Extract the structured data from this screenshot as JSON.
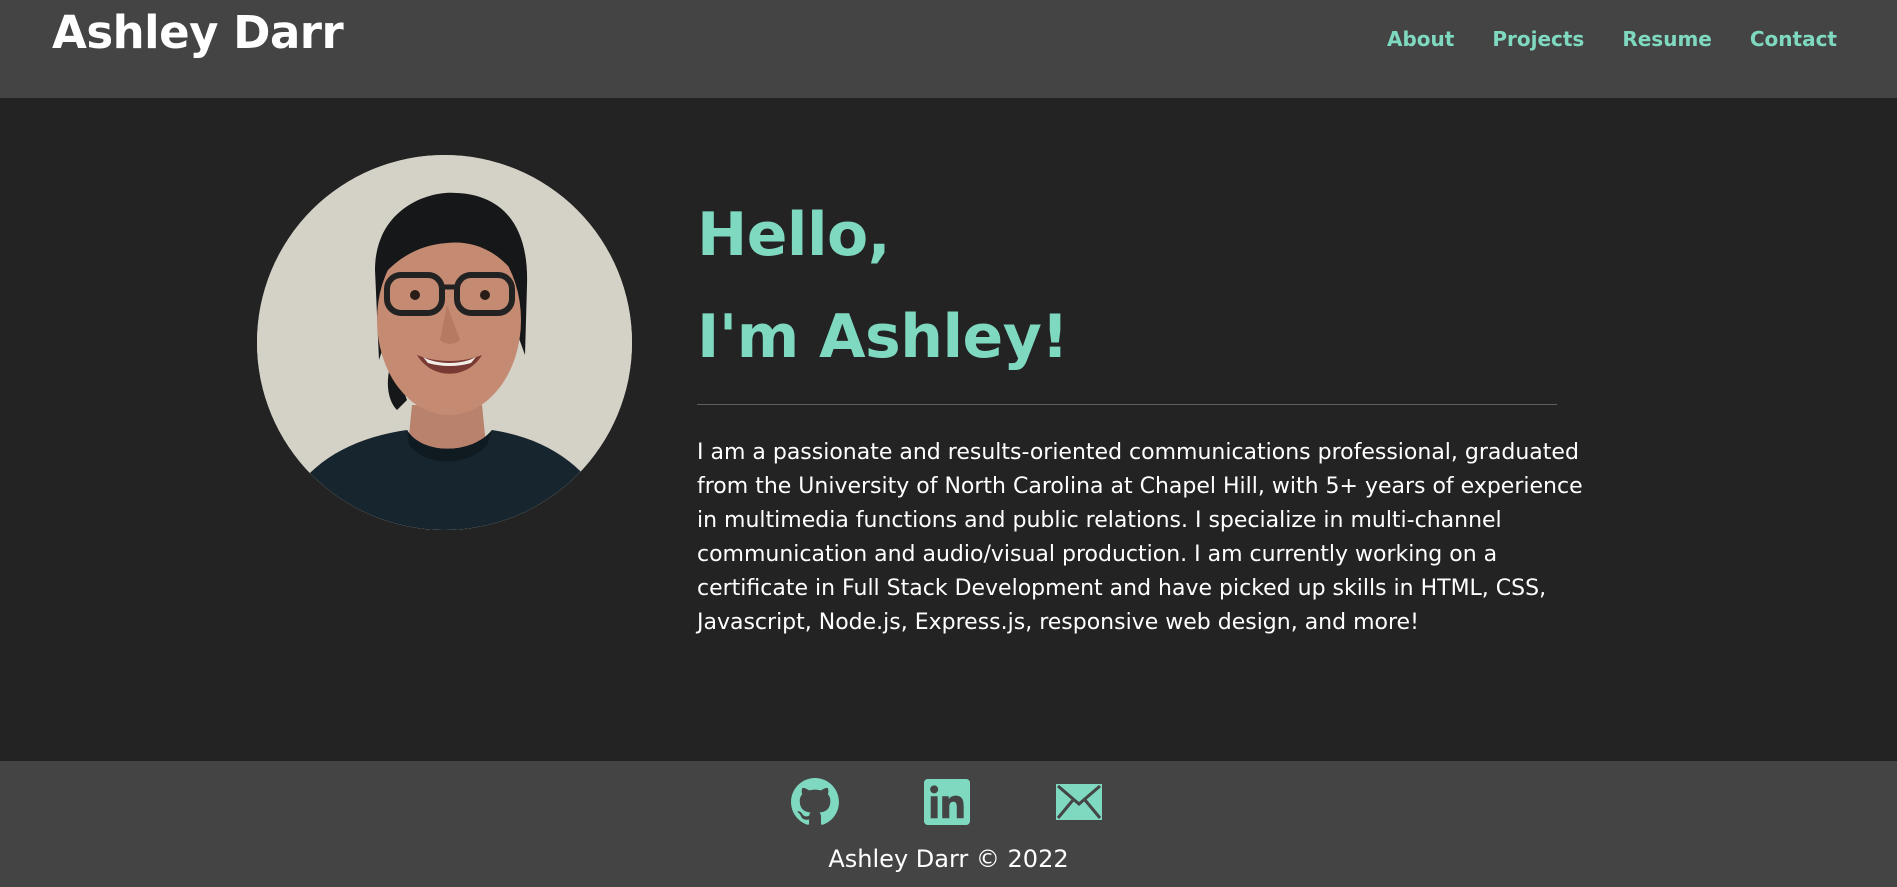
{
  "header": {
    "brand": "Ashley Darr",
    "nav": [
      {
        "label": "About"
      },
      {
        "label": "Projects"
      },
      {
        "label": "Resume"
      },
      {
        "label": "Contact"
      }
    ]
  },
  "hero": {
    "greeting_line1": "Hello,",
    "greeting_line2": "I'm Ashley!",
    "bio": "I am a passionate and results-oriented communications professional, graduated from the University of North Carolina at Chapel Hill, with 5+ years of experience in multimedia functions and public relations. I specialize in multi-channel communication and audio/visual production. I am currently working on a certificate in Full Stack Development and have picked up skills in HTML, CSS, Javascript, Node.js, Express.js, responsive web design, and more!"
  },
  "footer": {
    "social": [
      {
        "icon": "github-icon"
      },
      {
        "icon": "linkedin-icon"
      },
      {
        "icon": "mail-icon"
      }
    ],
    "copyright": "Ashley Darr © 2022"
  },
  "colors": {
    "accent": "#7fd9c0",
    "header_bg": "#444444",
    "body_bg": "#232323",
    "text": "#ffffff"
  }
}
